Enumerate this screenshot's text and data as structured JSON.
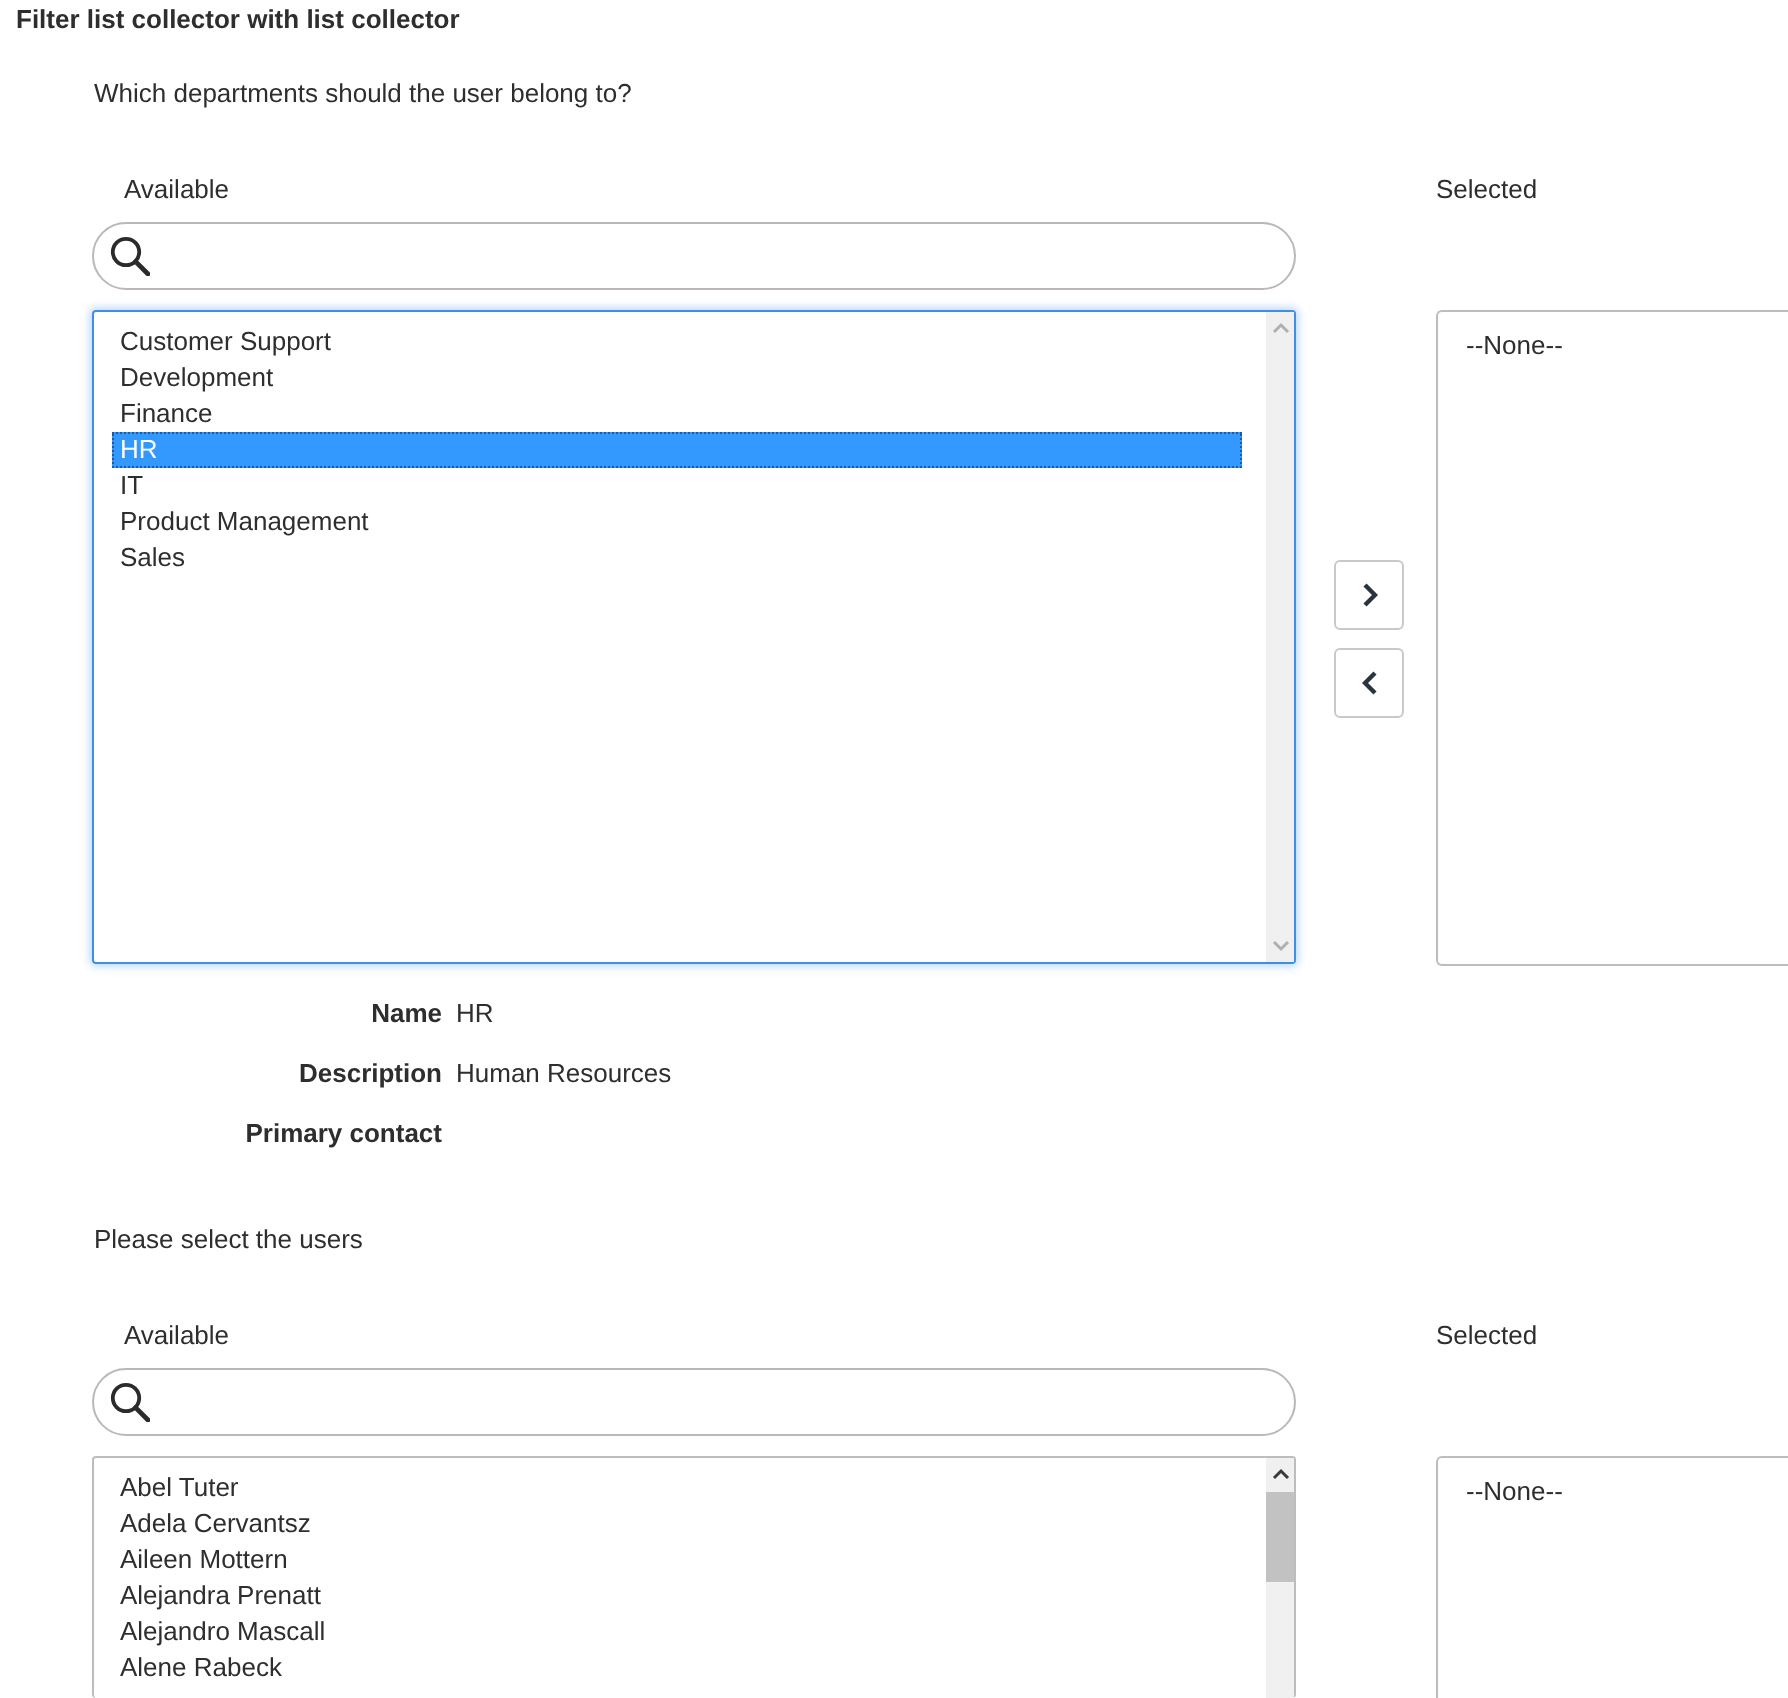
{
  "title": "Filter list collector with list collector",
  "collectors": [
    {
      "question": "Which departments should the user belong to?",
      "available_list": {
        "label": "Available",
        "focused": true,
        "scrollable": false,
        "items": [
          {
            "label": "Customer Support",
            "selected": false
          },
          {
            "label": "Development",
            "selected": false
          },
          {
            "label": "Finance",
            "selected": false
          },
          {
            "label": "HR",
            "selected": true
          },
          {
            "label": "IT",
            "selected": false
          },
          {
            "label": "Product Management",
            "selected": false
          },
          {
            "label": "Sales",
            "selected": false
          }
        ]
      },
      "buttons": [
        {
          "kind": "add"
        },
        {
          "kind": "remove"
        }
      ],
      "selected_list": {
        "label": "Selected",
        "items": [
          {
            "label": "--None--",
            "selected": false
          }
        ]
      },
      "details": [
        {
          "label": "Name",
          "value": "HR"
        },
        {
          "label": "Description",
          "value": "Human Resources"
        },
        {
          "label": "Primary contact"
        }
      ]
    },
    {
      "question": "Please select the users",
      "available_list": {
        "label": "Available",
        "focused": false,
        "scrollable": true,
        "items": [
          {
            "label": "Abel Tuter",
            "selected": false
          },
          {
            "label": "Adela Cervantsz",
            "selected": false
          },
          {
            "label": "Aileen Mottern",
            "selected": false
          },
          {
            "label": "Alejandra Prenatt",
            "selected": false
          },
          {
            "label": "Alejandro Mascall",
            "selected": false
          },
          {
            "label": "Alene Rabeck",
            "selected": false
          }
        ]
      },
      "selected_list": {
        "label": "Selected",
        "items": [
          {
            "label": "--None--",
            "selected": false
          }
        ]
      }
    }
  ]
}
